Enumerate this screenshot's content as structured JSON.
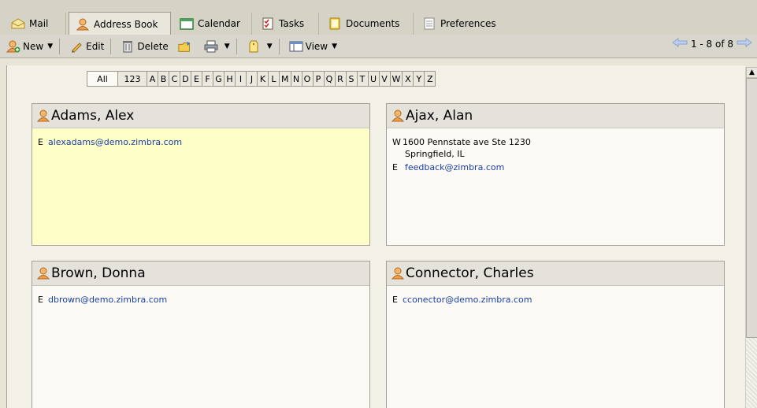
{
  "tabs": [
    {
      "label": "Mail",
      "icon": "mail-icon"
    },
    {
      "label": "Address Book",
      "icon": "contact-icon"
    },
    {
      "label": "Calendar",
      "icon": "calendar-icon"
    },
    {
      "label": "Tasks",
      "icon": "tasks-icon"
    },
    {
      "label": "Documents",
      "icon": "documents-icon"
    },
    {
      "label": "Preferences",
      "icon": "preferences-icon"
    }
  ],
  "toolbar": {
    "new_label": "New",
    "edit_label": "Edit",
    "delete_label": "Delete",
    "view_label": "View",
    "page_range": "1 - 8 of 8"
  },
  "alphabet": [
    "All",
    "123",
    "A",
    "B",
    "C",
    "D",
    "E",
    "F",
    "G",
    "H",
    "I",
    "J",
    "K",
    "L",
    "M",
    "N",
    "O",
    "P",
    "Q",
    "R",
    "S",
    "T",
    "U",
    "V",
    "W",
    "X",
    "Y",
    "Z"
  ],
  "contacts": [
    {
      "name": "Adams, Alex",
      "email": "alexadams@demo.zimbra.com"
    },
    {
      "name": "Ajax, Alan",
      "address_line1": "1600 Pennstate ave Ste 1230",
      "address_line2": "Springfield, IL",
      "email": "feedback@zimbra.com"
    },
    {
      "name": "Brown, Donna",
      "email": "dbrown@demo.zimbra.com"
    },
    {
      "name": "Connector, Charles",
      "email": "cconector@demo.zimbra.com"
    }
  ],
  "labels": {
    "email_key": "E",
    "work_key": "W"
  },
  "colors": {
    "link": "#1a3fa3",
    "selected_card": "#fefec9",
    "toolbar": "#d8d6cd"
  }
}
